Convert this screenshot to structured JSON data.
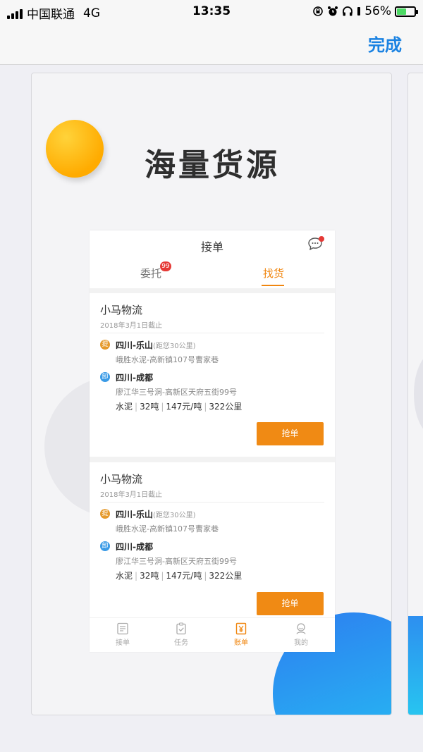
{
  "status_bar": {
    "carrier": "中国联通",
    "network": "4G",
    "time": "13:35",
    "battery": "56%"
  },
  "nav": {
    "done_label": "完成"
  },
  "guide": {
    "headline": "海量货源"
  },
  "phone": {
    "title": "接单",
    "tabs": [
      {
        "label": "委托",
        "badge": "99"
      },
      {
        "label": "找货"
      }
    ],
    "orders": [
      {
        "company": "小马物流",
        "deadline": "2018年3月1日截止",
        "pickup_tag": "提",
        "pickup_route": "四川-乐山",
        "pickup_distance": "(距您30公里)",
        "pickup_address": "峨胜水泥-高新镇107号曹家巷",
        "drop_tag": "卸",
        "drop_route": "四川-成都",
        "drop_address": "廖江华三号洞-高新区天府五街99号",
        "spec": [
          "水泥",
          "32吨",
          "147元/吨",
          "322公里"
        ],
        "action": "抢单"
      },
      {
        "company": "小马物流",
        "deadline": "2018年3月1日截止",
        "pickup_tag": "提",
        "pickup_route": "四川-乐山",
        "pickup_distance": "(距您30公里)",
        "pickup_address": "峨胜水泥-高新镇107号曹家巷",
        "drop_tag": "卸",
        "drop_route": "四川-成都",
        "drop_address": "廖江华三号洞-高新区天府五街99号",
        "spec": [
          "水泥",
          "32吨",
          "147元/吨",
          "322公里"
        ],
        "action": "抢单"
      }
    ],
    "bottom_tabs": [
      "接单",
      "任务",
      "账单",
      "我的"
    ]
  },
  "colors": {
    "accent_blue": "#1a82e2",
    "accent_orange": "#f08a14"
  }
}
